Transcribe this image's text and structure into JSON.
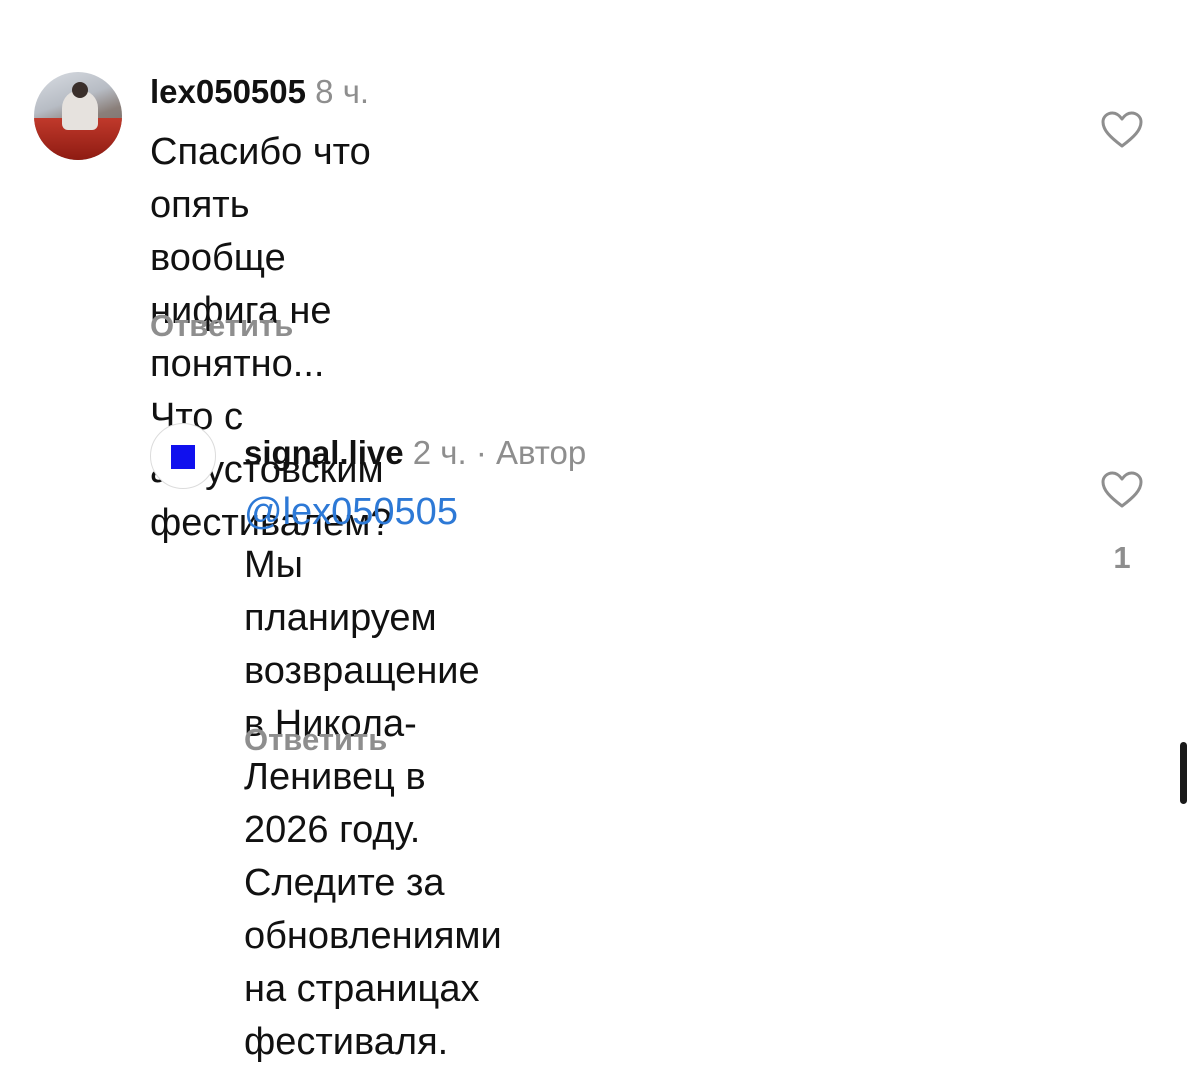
{
  "comments": [
    {
      "username": "lex050505",
      "time": "8 ч.",
      "text_lines": [
        "Спасибо что опять вообще нифига не",
        "понятно... Что с августовским",
        "фестивалем?"
      ],
      "reply_label": "Ответить"
    },
    {
      "username": "signal.live",
      "time": "2 ч.",
      "separator": "·",
      "author_label": "Автор",
      "mention": "@lex050505",
      "text_first": " Мы планируем",
      "text_lines": [
        "возвращение в Никола-Ленивец в",
        "2026 году. Следите за обновлениями",
        "на страницах фестиваля."
      ],
      "like_count": "1",
      "reply_label": "Ответить"
    }
  ],
  "colors": {
    "text": "#111111",
    "muted": "#8e8e8e",
    "mention": "#2d79d6",
    "brand_square": "#1010ee"
  },
  "icons": {
    "like": "heart-outline-icon"
  }
}
